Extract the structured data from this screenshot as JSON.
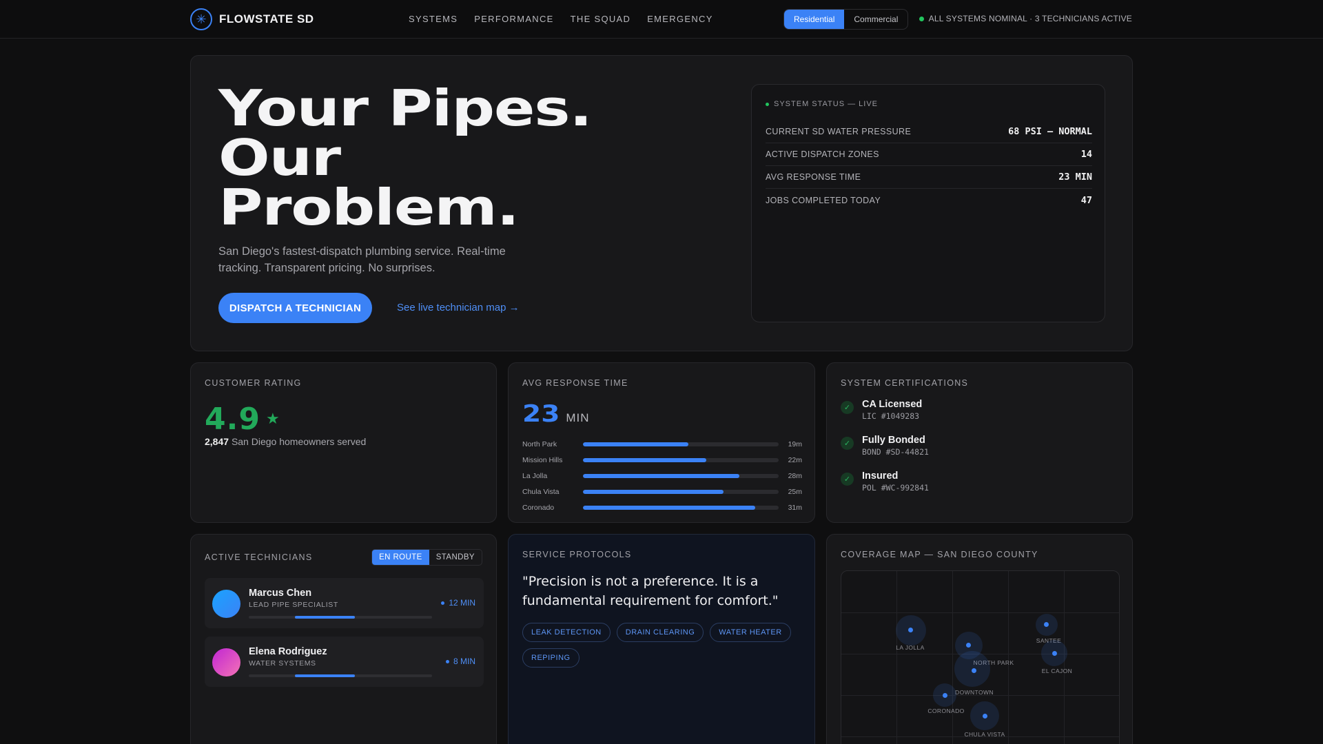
{
  "nav": {
    "brand": "FLOWSTATE SD",
    "brand_icon": "snowflake-icon",
    "links": [
      "SYSTEMS",
      "PERFORMANCE",
      "THE SQUAD",
      "EMERGENCY"
    ],
    "segment": [
      "Residential",
      "Commercial"
    ],
    "segment_active": "Residential",
    "status": "ALL SYSTEMS NOMINAL · 3 TECHNICIANS ACTIVE"
  },
  "hero": {
    "headline": [
      "Your Pipes.",
      "Our",
      "Problem."
    ],
    "subtitle": "San Diego's fastest-dispatch plumbing service. Real-time tracking. Transparent pricing. No surprises.",
    "cta": "DISPATCH A TECHNICIAN",
    "link": "See live technician map →",
    "status_panel": {
      "title": "SYSTEM STATUS — LIVE",
      "rows": [
        {
          "label": "CURRENT SD WATER PRESSURE",
          "value": "68 PSI — NORMAL"
        },
        {
          "label": "ACTIVE DISPATCH ZONES",
          "value": "14"
        },
        {
          "label": "AVG RESPONSE TIME",
          "value": "23 MIN"
        },
        {
          "label": "JOBS COMPLETED TODAY",
          "value": "47"
        }
      ]
    }
  },
  "rating": {
    "title": "CUSTOMER RATING",
    "value": "4.9",
    "star": "★",
    "count": "2,847",
    "count_label": "San Diego homeowners served"
  },
  "response": {
    "title": "AVG RESPONSE TIME",
    "value": "23",
    "unit": "MIN",
    "zones": [
      {
        "name": "North Park",
        "label": "19m",
        "fill": 0.54
      },
      {
        "name": "Mission Hills",
        "label": "22m",
        "fill": 0.63
      },
      {
        "name": "La Jolla",
        "label": "28m",
        "fill": 0.8
      },
      {
        "name": "Chula Vista",
        "label": "25m",
        "fill": 0.72
      },
      {
        "name": "Coronado",
        "label": "31m",
        "fill": 0.88
      }
    ]
  },
  "certs": {
    "title": "SYSTEM CERTIFICATIONS",
    "items": [
      {
        "name": "CA Licensed",
        "id": "LIC #1049283"
      },
      {
        "name": "Fully Bonded",
        "id": "BOND #SD-44821"
      },
      {
        "name": "Insured",
        "id": "POL #WC-992841"
      }
    ]
  },
  "technicians": {
    "title": "ACTIVE TECHNICIANS",
    "toggle": [
      "EN ROUTE",
      "STANDBY"
    ],
    "toggle_active": "EN ROUTE",
    "list": [
      {
        "name": "Marcus Chen",
        "role": "LEAD PIPE SPECIALIST",
        "eta": "12 MIN",
        "progress_start": 0.25,
        "progress_end": 0.58,
        "avatar_colors": [
          "#1aa3ff",
          "#3b82f6"
        ]
      },
      {
        "name": "Elena Rodriguez",
        "role": "WATER SYSTEMS",
        "eta": "8 MIN",
        "progress_start": 0.25,
        "progress_end": 0.58,
        "avatar_colors": [
          "#c026d3",
          "#f472b6"
        ]
      }
    ]
  },
  "protocols": {
    "title": "SERVICE PROTOCOLS",
    "quote": "\"Precision is not a preference. It is a fundamental requirement for comfort.\"",
    "tags": [
      "LEAK DETECTION",
      "DRAIN CLEARING",
      "WATER HEATER",
      "REPIPING"
    ]
  },
  "map": {
    "title": "COVERAGE MAP — SAN DIEGO COUNTY",
    "locations": [
      "LA JOLLA",
      "NORTH PARK",
      "SANTEE",
      "EL CAJON",
      "DOWNTOWN",
      "CORONADO",
      "CHULA VISTA"
    ]
  },
  "colors": {
    "accent": "#3b82f6",
    "success": "#22a95a",
    "status_dot": "#22c55e"
  }
}
